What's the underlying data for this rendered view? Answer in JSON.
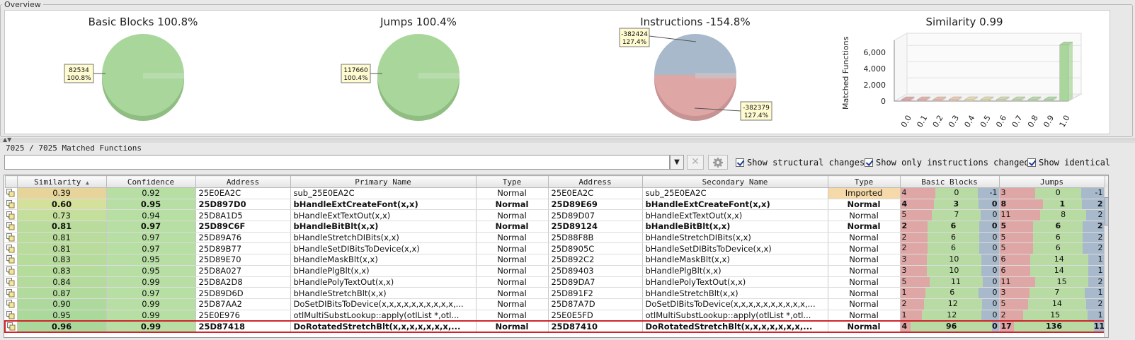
{
  "overview": {
    "title": "Overview",
    "charts": [
      {
        "title": "Basic Blocks 100.8%",
        "tooltip": [
          "82534",
          "100.8%"
        ]
      },
      {
        "title": "Jumps 100.4%",
        "tooltip": [
          "117660",
          "100.4%"
        ]
      },
      {
        "title": "Instructions -154.8%",
        "tooltip_top": [
          "-382424",
          "127.4%"
        ],
        "tooltip_bottom": [
          "-382379",
          "127.4%"
        ]
      },
      {
        "title": "Similarity 0.99"
      }
    ]
  },
  "chart_data": [
    {
      "type": "pie",
      "title": "Basic Blocks 100.8%",
      "slices": [
        {
          "value": 82534,
          "percent": 100.8,
          "color": "#a9d69b"
        }
      ]
    },
    {
      "type": "pie",
      "title": "Jumps 100.4%",
      "slices": [
        {
          "value": 117660,
          "percent": 100.4,
          "color": "#a9d69b"
        }
      ]
    },
    {
      "type": "pie",
      "title": "Instructions -154.8%",
      "slices": [
        {
          "value": -382424,
          "percent": 127.4,
          "color": "#a9b9cc"
        },
        {
          "value": -382379,
          "percent": 127.4,
          "color": "#dfa6a6"
        }
      ]
    },
    {
      "type": "bar",
      "title": "Similarity 0.99",
      "ylabel": "Matched Functions",
      "categories": [
        "0.0",
        "0.1",
        "0.2",
        "0.3",
        "0.4",
        "0.5",
        "0.6",
        "0.7",
        "0.8",
        "0.9",
        "1.0"
      ],
      "values": [
        5,
        5,
        5,
        5,
        5,
        5,
        5,
        5,
        5,
        5,
        6950
      ],
      "yticks": [
        "0",
        "2,000",
        "4,000",
        "6,000"
      ],
      "ylim": [
        0,
        7500
      ],
      "bar_colors": [
        "#dfa6a6",
        "#e3b0a8",
        "#e7bcaa",
        "#ebc8ae",
        "#e6d8b0",
        "#dcd8ac",
        "#cfd6aa",
        "#c2d6a8",
        "#b7d8a6",
        "#aed8a3",
        "#a9d69b"
      ]
    }
  ],
  "matched_label": "7025 / 7025 Matched Functions",
  "filter": {
    "value": "",
    "cb_structural": "Show structural changes",
    "cb_instructions": "Show only instructions changed",
    "cb_identical": "Show identical"
  },
  "columns": [
    "",
    "Similarity",
    "Confidence",
    "Address",
    "Primary Name",
    "Type",
    "Address",
    "Secondary Name",
    "Type",
    "Basic Blocks",
    "Jumps"
  ],
  "rows": [
    {
      "sim": "0.39",
      "conf": "0.92",
      "addr1": "25E0EA2C",
      "name1": "sub_25E0EA2C",
      "type1": "Normal",
      "addr2": "25E0EA2C",
      "name2": "sub_25E0EA2C",
      "type2": "Imported",
      "bb": [
        "4",
        "0",
        "-1"
      ],
      "jmp": [
        "3",
        "0",
        "-1"
      ],
      "sim_color": "#e6d49a",
      "bold": false,
      "type2_color": "#f5d9a8",
      "hl": false
    },
    {
      "sim": "0.60",
      "conf": "0.95",
      "addr1": "25D897D0",
      "name1": "bHandleExtCreateFont(x,x)",
      "type1": "Normal",
      "addr2": "25D89E69",
      "name2": "bHandleExtCreateFont(x,x)",
      "type2": "Normal",
      "bb": [
        "4",
        "3",
        "0"
      ],
      "jmp": [
        "8",
        "1",
        "2"
      ],
      "sim_color": "#d4e19b",
      "bold": true,
      "type2_color": "",
      "hl": false
    },
    {
      "sim": "0.73",
      "conf": "0.94",
      "addr1": "25D8A1D5",
      "name1": "bHandleExtTextOut(x,x)",
      "type1": "Normal",
      "addr2": "25D89D07",
      "name2": "bHandleExtTextOut(x,x)",
      "type2": "Normal",
      "bb": [
        "5",
        "7",
        "0"
      ],
      "jmp": [
        "11",
        "8",
        "2"
      ],
      "sim_color": "#c4df9c",
      "bold": false,
      "type2_color": "",
      "hl": false
    },
    {
      "sim": "0.81",
      "conf": "0.97",
      "addr1": "25D89C6F",
      "name1": "bHandleBitBlt(x,x)",
      "type1": "Normal",
      "addr2": "25D89124",
      "name2": "bHandleBitBlt(x,x)",
      "type2": "Normal",
      "bb": [
        "2",
        "6",
        "0"
      ],
      "jmp": [
        "5",
        "6",
        "2"
      ],
      "sim_color": "#b9dc9c",
      "bold": true,
      "type2_color": "",
      "hl": false
    },
    {
      "sim": "0.81",
      "conf": "0.97",
      "addr1": "25D89A76",
      "name1": "bHandleStretchDIBits(x,x)",
      "type1": "Normal",
      "addr2": "25D88F8B",
      "name2": "bHandleStretchDIBits(x,x)",
      "type2": "Normal",
      "bb": [
        "2",
        "6",
        "0"
      ],
      "jmp": [
        "5",
        "6",
        "2"
      ],
      "sim_color": "#b9dc9c",
      "bold": false,
      "type2_color": "",
      "hl": false
    },
    {
      "sim": "0.81",
      "conf": "0.97",
      "addr1": "25D89B77",
      "name1": "bHandleSetDIBitsToDevice(x,x)",
      "type1": "Normal",
      "addr2": "25D8905C",
      "name2": "bHandleSetDIBitsToDevice(x,x)",
      "type2": "Normal",
      "bb": [
        "2",
        "6",
        "0"
      ],
      "jmp": [
        "5",
        "6",
        "2"
      ],
      "sim_color": "#b9dc9c",
      "bold": false,
      "type2_color": "",
      "hl": false
    },
    {
      "sim": "0.83",
      "conf": "0.95",
      "addr1": "25D89E70",
      "name1": "bHandleMaskBlt(x,x)",
      "type1": "Normal",
      "addr2": "25D892C2",
      "name2": "bHandleMaskBlt(x,x)",
      "type2": "Normal",
      "bb": [
        "3",
        "10",
        "0"
      ],
      "jmp": [
        "6",
        "14",
        "1"
      ],
      "sim_color": "#b6dc9c",
      "bold": false,
      "type2_color": "",
      "hl": false
    },
    {
      "sim": "0.83",
      "conf": "0.95",
      "addr1": "25D8A027",
      "name1": "bHandlePlgBlt(x,x)",
      "type1": "Normal",
      "addr2": "25D89403",
      "name2": "bHandlePlgBlt(x,x)",
      "type2": "Normal",
      "bb": [
        "3",
        "10",
        "0"
      ],
      "jmp": [
        "6",
        "14",
        "1"
      ],
      "sim_color": "#b6dc9c",
      "bold": false,
      "type2_color": "",
      "hl": false
    },
    {
      "sim": "0.84",
      "conf": "0.99",
      "addr1": "25D8A2D8",
      "name1": "bHandlePolyTextOut(x,x)",
      "type1": "Normal",
      "addr2": "25D89DA7",
      "name2": "bHandlePolyTextOut(x,x)",
      "type2": "Normal",
      "bb": [
        "5",
        "11",
        "0"
      ],
      "jmp": [
        "11",
        "15",
        "2"
      ],
      "sim_color": "#b4db9c",
      "bold": false,
      "type2_color": "",
      "hl": false
    },
    {
      "sim": "0.87",
      "conf": "0.97",
      "addr1": "25D89D6D",
      "name1": "bHandleStretchBlt(x,x)",
      "type1": "Normal",
      "addr2": "25D891F2",
      "name2": "bHandleStretchBlt(x,x)",
      "type2": "Normal",
      "bb": [
        "1",
        "6",
        "0"
      ],
      "jmp": [
        "3",
        "7",
        "1"
      ],
      "sim_color": "#b1da9c",
      "bold": false,
      "type2_color": "",
      "hl": false
    },
    {
      "sim": "0.90",
      "conf": "0.99",
      "addr1": "25D87AA2",
      "name1": "DoSetDIBitsToDevice(x,x,x,x,x,x,x,x,x,x,...",
      "type1": "Normal",
      "addr2": "25D87A7D",
      "name2": "DoSetDIBitsToDevice(x,x,x,x,x,x,x,x,x,x,...",
      "type2": "Normal",
      "bb": [
        "2",
        "12",
        "0"
      ],
      "jmp": [
        "5",
        "14",
        "2"
      ],
      "sim_color": "#aed99c",
      "bold": false,
      "type2_color": "",
      "hl": false
    },
    {
      "sim": "0.95",
      "conf": "0.99",
      "addr1": "25E0E976",
      "name1": "otlMultiSubstLookup::apply(otlList *,otl...",
      "type1": "Normal",
      "addr2": "25E0E5FD",
      "name2": "otlMultiSubstLookup::apply(otlList *,otl...",
      "type2": "Normal",
      "bb": [
        "1",
        "12",
        "0"
      ],
      "jmp": [
        "2",
        "15",
        "1"
      ],
      "sim_color": "#abd89b",
      "bold": false,
      "type2_color": "",
      "hl": false
    },
    {
      "sim": "0.96",
      "conf": "0.99",
      "addr1": "25D87418",
      "name1": "DoRotatedStretchBlt(x,x,x,x,x,x,x,...",
      "type1": "Normal",
      "addr2": "25D87410",
      "name2": "DoRotatedStretchBlt(x,x,x,x,x,x,x,...",
      "type2": "Normal",
      "bb": [
        "4",
        "96",
        "0"
      ],
      "jmp": [
        "17",
        "136",
        "11"
      ],
      "sim_color": "#aad89b",
      "bold": true,
      "type2_color": "",
      "hl": true
    }
  ]
}
